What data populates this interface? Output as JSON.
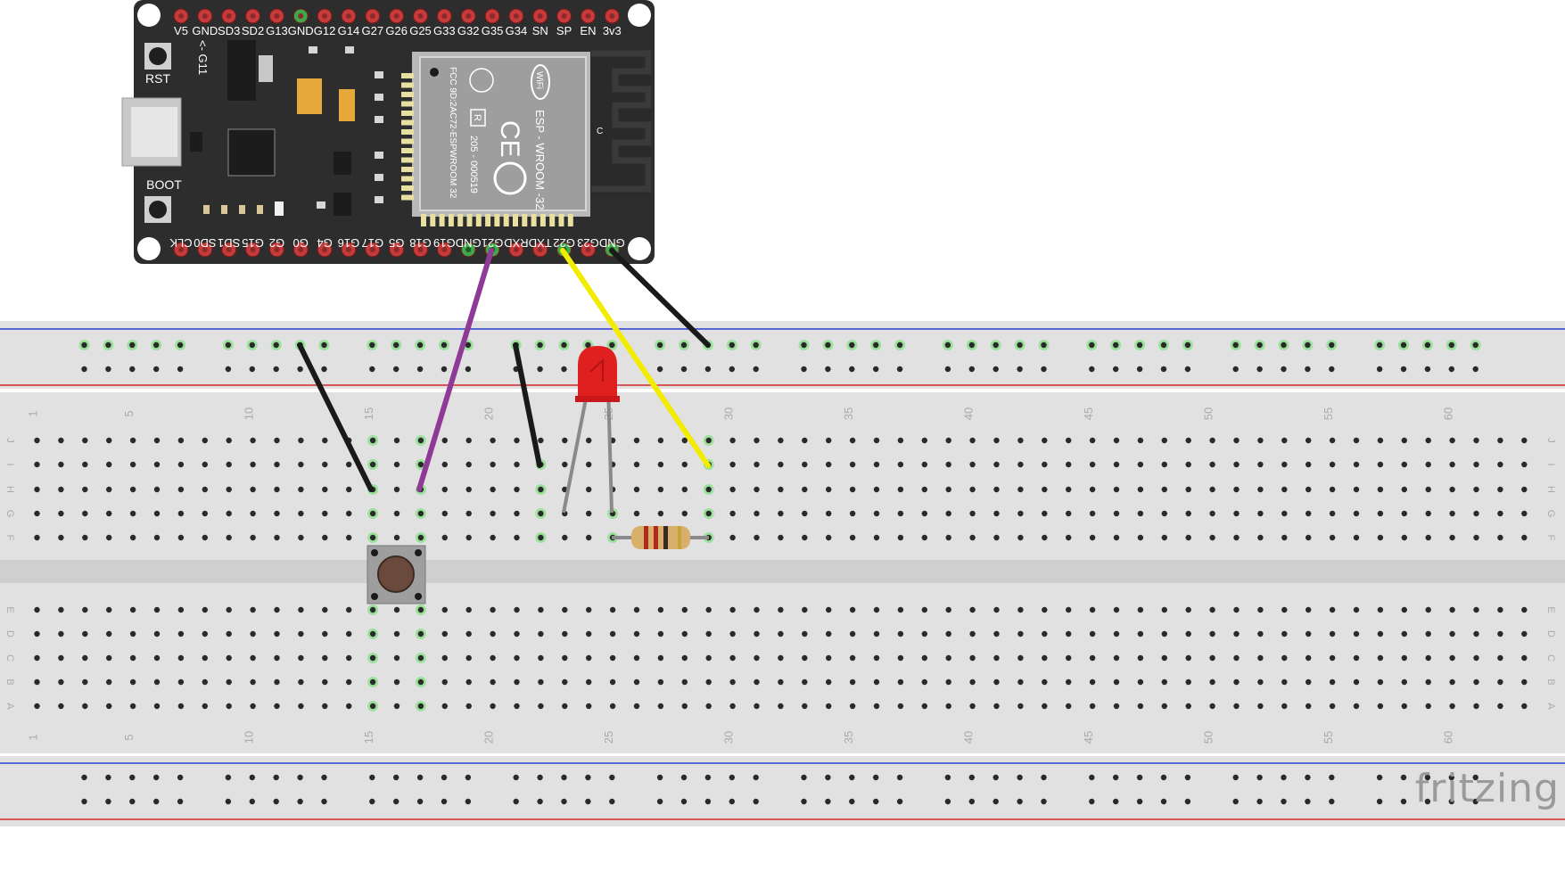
{
  "esp32": {
    "top_pins": [
      "V5",
      "GND",
      "SD3",
      "SD2",
      "G13",
      "GND",
      "G12",
      "G14",
      "G27",
      "G26",
      "G25",
      "G33",
      "G32",
      "G35",
      "G34",
      "SN",
      "SP",
      "EN",
      "3v3"
    ],
    "bottom_pins": [
      "CLK",
      "SD0",
      "SD1",
      "G15",
      "G2",
      "G0",
      "G4",
      "G16",
      "G17",
      "G5",
      "G18",
      "G19",
      "GND",
      "G21",
      "RXD",
      "TXD",
      "G22",
      "G23",
      "GND"
    ],
    "rst_label": "RST",
    "boot_label": "BOOT",
    "g11_label": "<- G11",
    "module_text": {
      "model": "ESP - WROOM -32",
      "fcc": "FCC 9D:2AC72-ESPWROOM 32",
      "cert": "205 - 000519",
      "r_mark": "R",
      "ce_mark": "CE",
      "wifi": "WiFi",
      "antenna_mark": "C"
    }
  },
  "breadboard": {
    "row_letters_top": [
      "J",
      "I",
      "H",
      "G",
      "F"
    ],
    "row_letters_bottom": [
      "E",
      "D",
      "C",
      "B",
      "A"
    ],
    "column_numbers": [
      "1",
      "5",
      "10",
      "15",
      "20",
      "25",
      "30",
      "35",
      "40",
      "45",
      "50",
      "55",
      "60"
    ]
  },
  "wires": [
    {
      "name": "ground-wire-rail-to-button",
      "color": "#1a1a1a"
    },
    {
      "name": "signal-wire-g21-to-button",
      "color": "#8e3a96"
    },
    {
      "name": "ground-wire-rail-to-led",
      "color": "#1a1a1a"
    },
    {
      "name": "signal-wire-g22-to-resistor",
      "color": "#f1ec00"
    },
    {
      "name": "ground-wire-esp-to-rail",
      "color": "#1a1a1a"
    }
  ],
  "components": {
    "led_color": "#e0201f",
    "resistor_body_color": "#d8b06b",
    "button_cap_color": "#6b4a3e"
  },
  "rail_colors": {
    "blue": "#2b3fd4",
    "red": "#d42b2b"
  },
  "brand": "fritzing"
}
